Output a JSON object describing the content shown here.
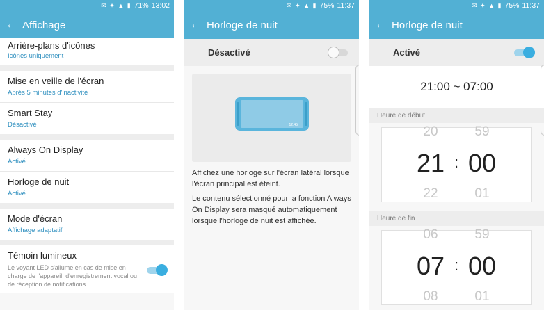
{
  "panel1": {
    "status": {
      "icons": "✉ ✦ ▲ ▮",
      "battery": "71%",
      "time": "13:02"
    },
    "title": "Affichage",
    "items": [
      {
        "title": "Arrière-plans d'icônes",
        "subtitle": "Icônes uniquement"
      },
      {
        "title": "Mise en veille de l'écran",
        "subtitle": "Après 5 minutes d'inactivité"
      },
      {
        "title": "Smart Stay",
        "subtitle": "Désactivé"
      },
      {
        "title": "Always On Display",
        "subtitle": "Activé"
      },
      {
        "title": "Horloge de nuit",
        "subtitle": "Activé"
      },
      {
        "title": "Mode d'écran",
        "subtitle": "Affichage adaptatif"
      },
      {
        "title": "Témoin lumineux",
        "description": "Le voyant LED s'allume en cas de mise en charge de l'appareil, d'enregistrement vocal ou de réception de notifications.",
        "toggle": true
      }
    ]
  },
  "panel2": {
    "status": {
      "icons": "✉ ✦ ▲ ▮",
      "battery": "75%",
      "time": "11:37"
    },
    "title": "Horloge de nuit",
    "switch_label": "Désactivé",
    "switch_on": false,
    "preview_time": "12:45",
    "para1": "Affichez une horloge sur l'écran latéral lorsque l'écran principal est éteint.",
    "para2": "Le contenu sélectionné pour la fonction Always On Display sera masqué automatiquement lorsque l'horloge de nuit est affichée."
  },
  "panel3": {
    "status": {
      "icons": "✉ ✦ ▲ ▮",
      "battery": "75%",
      "time": "11:37"
    },
    "title": "Horloge de nuit",
    "switch_label": "Activé",
    "switch_on": true,
    "range": "21:00 ~ 07:00",
    "start": {
      "label": "Heure de début",
      "hour_prev": "20",
      "hour": "21",
      "hour_next": "22",
      "min_prev": "59",
      "min": "00",
      "min_next": "01"
    },
    "end": {
      "label": "Heure de fin",
      "hour_prev": "06",
      "hour": "07",
      "hour_next": "08",
      "min_prev": "59",
      "min": "00",
      "min_next": "01"
    }
  },
  "icons": {
    "back": "arrow-left-icon"
  },
  "colors": {
    "accent": "#52b0d4",
    "link": "#2e8fbf",
    "toggle_on": "#3aaee0"
  }
}
